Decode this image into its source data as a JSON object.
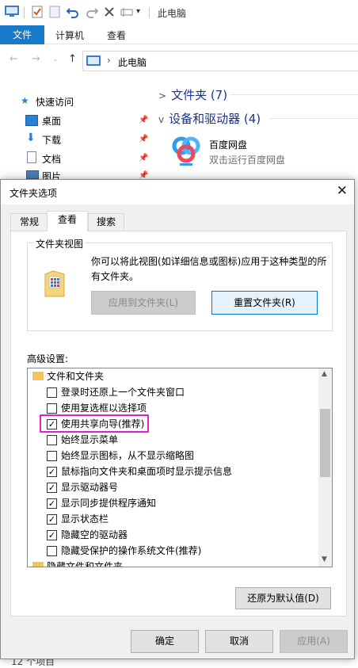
{
  "qat": {
    "title": "此电脑"
  },
  "ribbon": {
    "file": "文件",
    "tabs": [
      "计算机",
      "查看"
    ]
  },
  "address": {
    "crumb": "此电脑"
  },
  "navpane": {
    "quick_access": "快速访问",
    "items": [
      "桌面",
      "下载",
      "文档",
      "图片"
    ]
  },
  "content": {
    "folders_group": "文件夹 (7)",
    "devices_group": "设备和驱动器 (4)",
    "baidu_name": "百度网盘",
    "baidu_sub": "双击运行百度网盘"
  },
  "status": {
    "items": "12 个项目"
  },
  "dialog": {
    "title": "文件夹选项",
    "tabs": [
      "常规",
      "查看",
      "搜索"
    ],
    "folder_view_legend": "文件夹视图",
    "folder_view_desc": "你可以将此视图(如详细信息或图标)应用于这种类型的所有文件夹。",
    "apply_to_folders": "应用到文件夹(L)",
    "reset_folders": "重置文件夹(R)",
    "advanced_label": "高级设置:",
    "tree": [
      {
        "type": "folder",
        "label": "文件和文件夹"
      },
      {
        "type": "check",
        "label": "登录时还原上一个文件夹窗口",
        "checked": false
      },
      {
        "type": "check",
        "label": "使用复选框以选择项",
        "checked": false
      },
      {
        "type": "check",
        "label": "使用共享向导(推荐)",
        "checked": true,
        "highlighted": true
      },
      {
        "type": "check",
        "label": "始终显示菜单",
        "checked": false
      },
      {
        "type": "check",
        "label": "始终显示图标，从不显示缩略图",
        "checked": false
      },
      {
        "type": "check",
        "label": "鼠标指向文件夹和桌面项时显示提示信息",
        "checked": true
      },
      {
        "type": "check",
        "label": "显示驱动器号",
        "checked": true
      },
      {
        "type": "check",
        "label": "显示同步提供程序通知",
        "checked": true
      },
      {
        "type": "check",
        "label": "显示状态栏",
        "checked": true
      },
      {
        "type": "check",
        "label": "隐藏空的驱动器",
        "checked": true
      },
      {
        "type": "check",
        "label": "隐藏受保护的操作系统文件(推荐)",
        "checked": false
      },
      {
        "type": "folder",
        "label": "隐藏文件和文件夹"
      }
    ],
    "restore_defaults": "还原为默认值(D)",
    "ok": "确定",
    "cancel": "取消",
    "apply": "应用(A)"
  },
  "colors": {
    "accent": "#1979ca",
    "highlight": "#e020d0",
    "focus": "#0078d7"
  }
}
